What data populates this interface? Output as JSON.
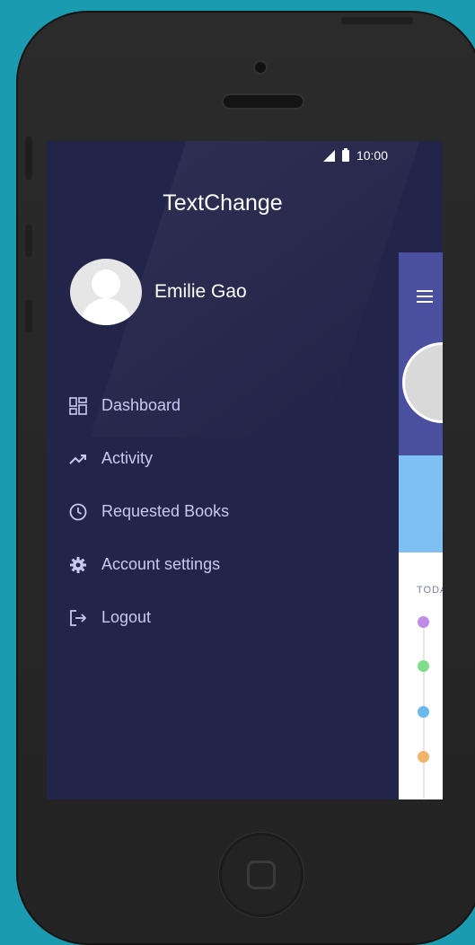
{
  "status_bar": {
    "time": "10:00"
  },
  "app": {
    "title": "TextChange"
  },
  "profile": {
    "name": "Emilie Gao"
  },
  "menu": {
    "items": [
      {
        "label": "Dashboard",
        "icon": "dashboard-grid-icon"
      },
      {
        "label": "Activity",
        "icon": "trend-icon"
      },
      {
        "label": "Requested Books",
        "icon": "clock-icon"
      },
      {
        "label": "Account settings",
        "icon": "gear-icon"
      },
      {
        "label": "Logout",
        "icon": "logout-icon"
      }
    ]
  },
  "background_app": {
    "today_label": "TODA",
    "dot_colors": [
      "#c18be6",
      "#7fdc8b",
      "#6bb8ec",
      "#f0b36a"
    ]
  },
  "colors": {
    "drawer_bg": "#232449",
    "menu_text": "#c7c9f2",
    "header_bg": "#4b4fa0",
    "accent_band": "#7ec0f3"
  }
}
